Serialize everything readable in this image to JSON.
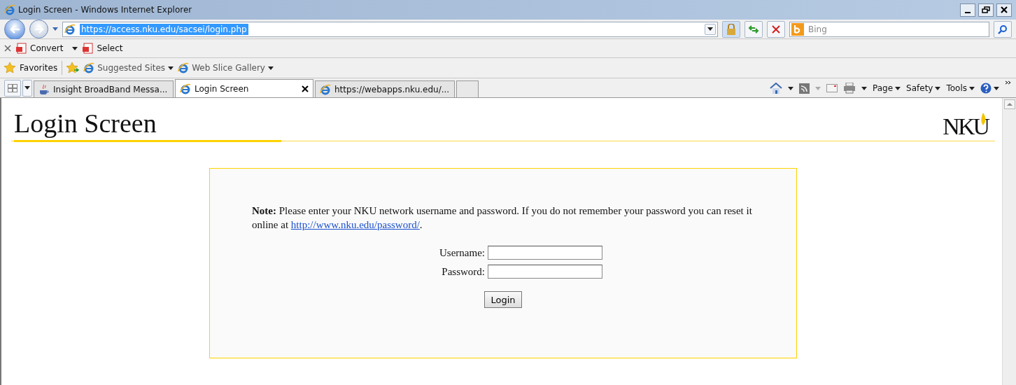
{
  "window": {
    "title": "Login Screen - Windows Internet Explorer"
  },
  "address_bar": {
    "url": "https://access.nku.edu/sacsei/login.php",
    "url_selected": true
  },
  "search": {
    "placeholder": "Bing"
  },
  "command_bar": [
    {
      "label": "Convert",
      "dropdown": true
    },
    {
      "label": "Select",
      "dropdown": false
    }
  ],
  "favorites_bar": {
    "label": "Favorites",
    "items": [
      {
        "label": "Suggested Sites"
      },
      {
        "label": "Web Slice Gallery"
      }
    ]
  },
  "tabs": [
    {
      "label": "Insight BroadBand Messa...",
      "kind": "java",
      "selected": false
    },
    {
      "label": "Login Screen",
      "kind": "ie",
      "selected": true
    },
    {
      "label": "https://webapps.nku.edu/...",
      "kind": "ie",
      "selected": false
    }
  ],
  "toolbar_menus": [
    "Page",
    "Safety",
    "Tools"
  ],
  "page": {
    "heading": "Login Screen",
    "logo": "NKU",
    "note": "**Note:** Please enter your NKU network username and password. If you do not remember your password you can reset it online at ",
    "link": "http://www.nku.edu/password/",
    "note_end": ".",
    "fields": [
      {
        "label": "Username:"
      },
      {
        "label": "Password:"
      }
    ],
    "button": "Login"
  }
}
